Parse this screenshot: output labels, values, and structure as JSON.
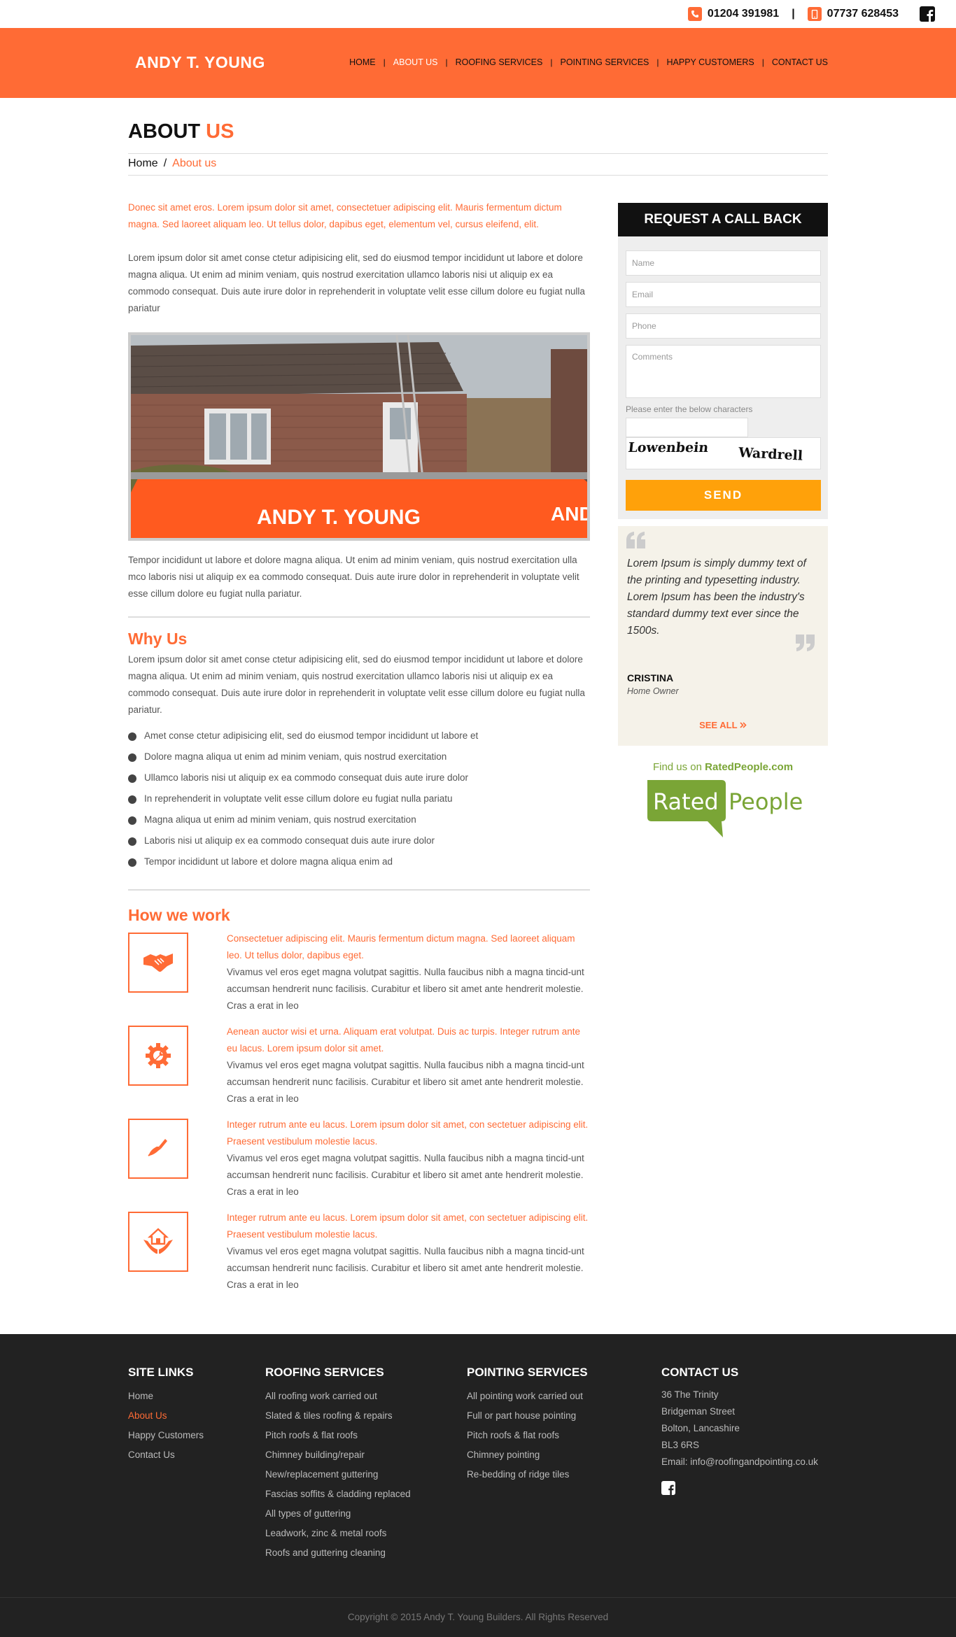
{
  "topbar": {
    "phone1": "01204 391981",
    "separator": "|",
    "phone2": "07737 628453",
    "icons": [
      "phone-icon",
      "mobile-icon",
      "facebook-icon"
    ]
  },
  "header": {
    "logo": "ANDY T. YOUNG",
    "nav": [
      {
        "label": "HOME"
      },
      {
        "label": "ABOUT US"
      },
      {
        "label": "ROOFING SERVICES"
      },
      {
        "label": "POINTING SERVICES"
      },
      {
        "label": "HAPPY CUSTOMERS"
      },
      {
        "label": "CONTACT US"
      }
    ],
    "nav_sep": "|"
  },
  "page": {
    "title_main": "ABOUT",
    "title_accent": "US",
    "breadcrumb_home": "Home",
    "breadcrumb_sep": "/",
    "breadcrumb_current": "About us"
  },
  "main": {
    "lead": "Donec sit amet eros. Lorem ipsum dolor sit amet, consectetuer adipiscing elit. Mauris fermentum dictum magna. Sed laoreet aliquam leo. Ut tellus dolor, dapibus eget, elementum vel, cursus eleifend, elit.",
    "intro": "Lorem ipsum dolor sit amet conse ctetur adipisicing elit, sed do eiusmod tempor incididunt ut labore et dolore magna aliqua. Ut enim ad minim veniam, quis nostrud exercitation ullamco laboris nisi ut aliquip ex ea commodo consequat. Duis aute irure dolor in reprehenderit in voluptate velit esse cillum dolore eu fugiat nulla pariatur",
    "van_text": "ANDY T. YOUNG",
    "van_text2": "AND",
    "after_image": "Tempor incididunt ut labore et dolore magna aliqua. Ut enim ad minim veniam, quis nostrud exercitation ulla mco laboris nisi ut aliquip ex ea commodo consequat. Duis aute irure dolor in reprehenderit in voluptate velit esse cillum dolore eu fugiat nulla pariatur.",
    "why_title": "Why Us",
    "why_text": "Lorem ipsum dolor sit amet conse ctetur adipisicing elit, sed do eiusmod tempor incididunt ut labore et dolore magna aliqua. Ut enim ad minim veniam, quis nostrud exercitation ullamco laboris nisi ut aliquip ex ea commodo consequat. Duis aute irure dolor in reprehenderit in voluptate velit esse cillum dolore eu fugiat nulla pariatur.",
    "bullets": [
      "Amet conse ctetur adipisicing elit, sed do eiusmod tempor incididunt ut labore et",
      "Dolore magna aliqua ut enim ad minim veniam, quis nostrud exercitation",
      "Ullamco laboris nisi ut aliquip ex ea commodo consequat duis aute irure dolor",
      "In reprehenderit in voluptate velit esse cillum dolore eu fugiat nulla pariatu",
      "Magna aliqua ut enim ad minim veniam, quis nostrud exercitation",
      "Laboris nisi ut aliquip ex ea commodo consequat duis aute irure dolor",
      "Tempor incididunt ut labore et dolore magna aliqua enim ad"
    ],
    "how_title": "How we work",
    "work": [
      {
        "icon": "handshake-icon",
        "lead": "Consectetuer adipiscing elit. Mauris fermentum dictum magna. Sed laoreet aliquam leo. Ut tellus dolor, dapibus eget.",
        "body": "Vivamus vel eros eget magna volutpat sagittis. Nulla faucibus nibh a magna tincid-unt accumsan hendrerit nunc facilisis. Curabitur et libero sit amet ante hendrerit molestie. Cras a erat in leo"
      },
      {
        "icon": "gear-wrench-icon",
        "lead": "Aenean auctor wisi et urna. Aliquam erat volutpat. Duis ac turpis. Integer rutrum ante eu lacus. Lorem ipsum dolor sit amet.",
        "body": "Vivamus vel eros eget magna volutpat sagittis. Nulla faucibus nibh a magna tincid-unt accumsan hendrerit nunc facilisis. Curabitur et libero sit amet ante hendrerit molestie. Cras a erat in leo"
      },
      {
        "icon": "trowel-icon",
        "lead": "Integer rutrum ante eu lacus. Lorem ipsum dolor sit amet, con sectetuer adipiscing elit. Praesent vestibulum molestie lacus.",
        "body": "Vivamus vel eros eget magna volutpat sagittis. Nulla faucibus nibh a magna tincid-unt accumsan hendrerit nunc facilisis. Curabitur et libero sit amet ante hendrerit molestie. Cras a erat in leo"
      },
      {
        "icon": "house-hands-icon",
        "lead": "Integer rutrum ante eu lacus. Lorem ipsum dolor sit amet, con sectetuer adipiscing elit. Praesent vestibulum molestie lacus.",
        "body": "Vivamus vel eros eget magna volutpat sagittis. Nulla faucibus nibh a magna tincid-unt accumsan hendrerit nunc facilisis. Curabitur et libero sit amet ante hendrerit molestie. Cras a erat in leo"
      }
    ]
  },
  "sidebar": {
    "callback_title": "REQUEST A CALL BACK",
    "name_placeholder": "Name",
    "email_placeholder": "Email",
    "phone_placeholder": "Phone",
    "comments_placeholder": "Comments",
    "captcha_label": "Please enter the below characters",
    "captcha_word1": "Lowenbein",
    "captcha_word2": "Wardrell",
    "send_label": "SEND",
    "testimonial_text": "Lorem Ipsum is simply dummy text of the printing and typesetting industry. Lorem Ipsum has been the industry's standard dummy text ever since the 1500s.",
    "testimonial_name": "CRISTINA",
    "testimonial_role": "Home Owner",
    "see_all": "SEE ALL",
    "find_us_prefix": "Find us on",
    "find_us_site": "RatedPeople.com",
    "rp_word1": "Rated",
    "rp_word2": "People"
  },
  "footer": {
    "site_links_title": "SITE LINKS",
    "site_links": [
      "Home",
      "About Us",
      "Happy Customers",
      "Contact Us"
    ],
    "roofing_title": "ROOFING SERVICES",
    "roofing": [
      "All roofing work carried out",
      "Slated & tiles roofing & repairs",
      "Pitch roofs & flat roofs",
      "Chimney building/repair",
      "New/replacement guttering",
      "Fascias soffits & cladding replaced",
      "All types of guttering",
      "Leadwork, zinc & metal roofs",
      "Roofs and guttering cleaning"
    ],
    "pointing_title": "POINTING SERVICES",
    "pointing": [
      "All pointing work carried out",
      "Full or part house pointing",
      "Pitch roofs & flat roofs",
      "Chimney pointing",
      "Re-bedding of ridge tiles"
    ],
    "contact_title": "CONTACT US",
    "address": [
      "36 The Trinity",
      "Bridgeman Street",
      "Bolton, Lancashire",
      "BL3 6RS"
    ],
    "email_line": "Email: info@roofingandpointing.co.uk",
    "copyright": "Copyright © 2015 Andy T. Young Builders. All Rights Reserved"
  },
  "colors": {
    "accent": "#ff6b35",
    "send": "#ffa10a",
    "dark": "#111111",
    "footer": "#222222",
    "rated_green": "#7aa536"
  }
}
